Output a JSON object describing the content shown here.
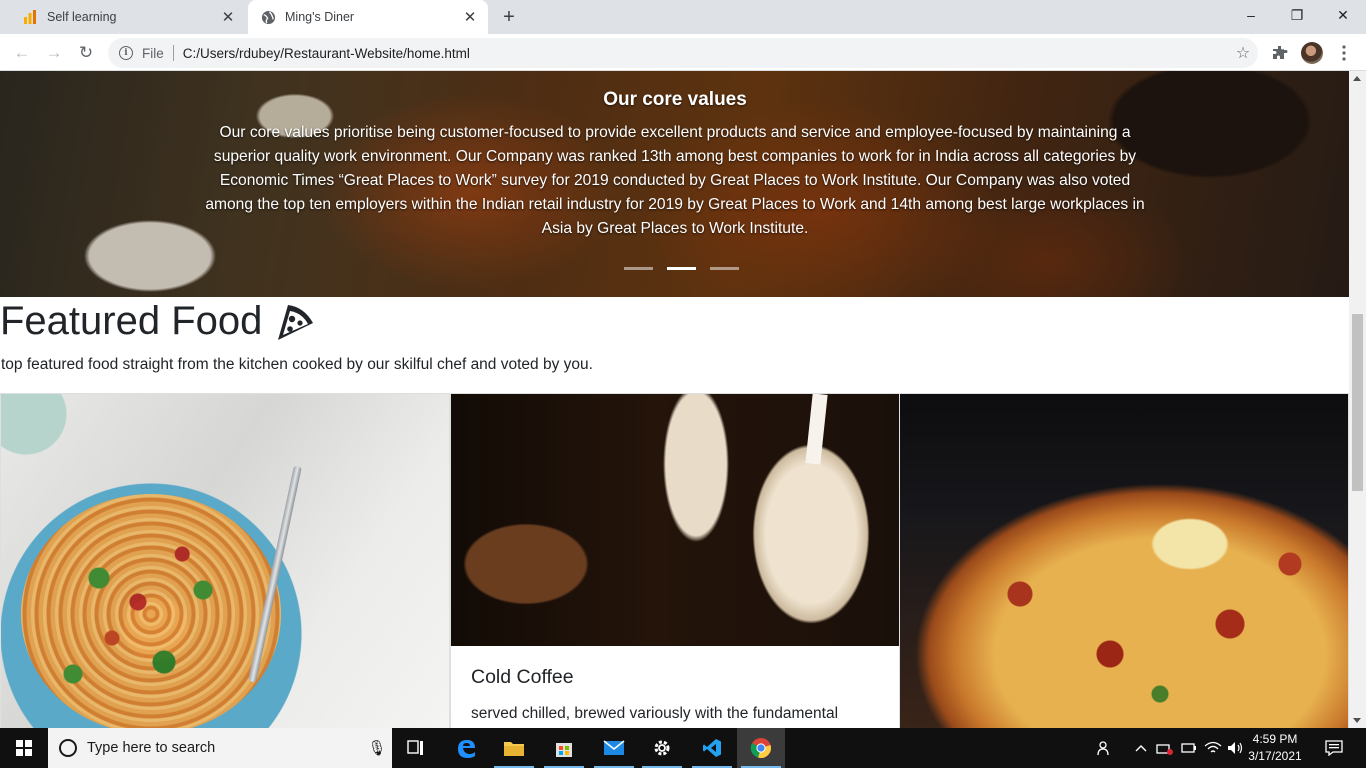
{
  "browser": {
    "tabs": [
      {
        "title": "Self learning",
        "active": false
      },
      {
        "title": "Ming's Diner",
        "active": true
      }
    ],
    "new_tab_glyph": "+",
    "window_controls": {
      "minimize": "–",
      "restore": "❐",
      "close": "✕"
    },
    "nav": {
      "back": "←",
      "forward": "→",
      "reload": "↻"
    },
    "address": {
      "info_glyph": "i",
      "scheme_label": "File",
      "url": "C:/Users/rdubey/Restaurant-Website/home.html"
    },
    "icons": [
      "bookmark-star-icon",
      "extensions-puzzle-icon",
      "profile-avatar",
      "menu-kebab-icon"
    ]
  },
  "page": {
    "carousel": {
      "heading": "Our core values",
      "text": "Our core values prioritise being customer-focused to provide excellent products and service and employee-focused by maintaining a superior quality work environment. Our Company was ranked 13th among best companies to work for in India across all categories by Economic Times “Great Places to Work” survey for 2019 conducted by Great Places to Work Institute. Our Company was also voted among the top ten employers within the Indian retail industry for 2019 by Great Places to Work and 14th among best large workplaces in Asia by Great Places to Work Institute.",
      "slide_count": 3,
      "active_slide": 2
    },
    "featured": {
      "title": "Featured Food",
      "title_icon": "pizza-slice-icon",
      "subtitle": "top featured food straight from the kitchen cooked by our skilful chef and voted by you."
    },
    "cards": [
      {
        "image": "pasta-image",
        "title": "",
        "text": ""
      },
      {
        "image": "cold-coffee-image",
        "title": "Cold Coffee",
        "text": "served chilled, brewed variously with the fundamental"
      },
      {
        "image": "pizza-image",
        "title": "",
        "text": ""
      }
    ]
  },
  "taskbar": {
    "search_placeholder": "Type here to search",
    "apps": [
      "task-view-icon",
      "edge-icon",
      "file-explorer-icon",
      "store-icon",
      "mail-icon",
      "settings-icon",
      "vscode-icon",
      "chrome-icon"
    ],
    "clock_time": "4:59 PM",
    "clock_date": "3/17/2021"
  },
  "colors": {
    "tabstrip_bg": "#dee1e6",
    "taskbar_bg": "#101010",
    "text_dark": "#212529"
  }
}
